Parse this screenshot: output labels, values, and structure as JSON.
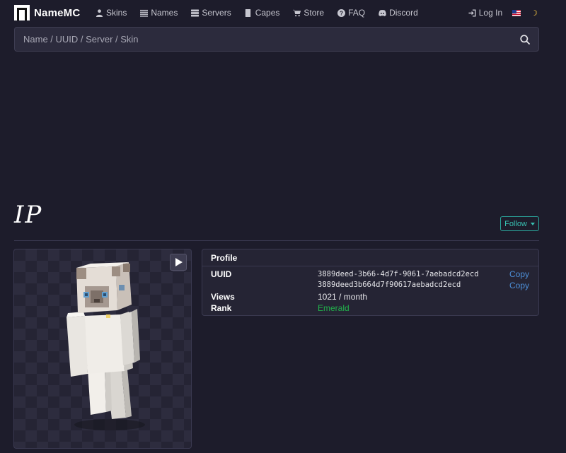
{
  "brand": {
    "name": "NameMC"
  },
  "nav": {
    "items": [
      {
        "label": "Skins",
        "icon": "person-icon"
      },
      {
        "label": "Names",
        "icon": "list-icon"
      },
      {
        "label": "Servers",
        "icon": "server-icon"
      },
      {
        "label": "Capes",
        "icon": "cape-icon"
      },
      {
        "label": "Store",
        "icon": "cart-icon"
      },
      {
        "label": "FAQ",
        "icon": "question-icon"
      },
      {
        "label": "Discord",
        "icon": "discord-icon"
      }
    ],
    "login_label": "Log In",
    "language": "us-flag-icon",
    "theme": "moon-icon"
  },
  "search": {
    "placeholder": "Name / UUID / Server / Skin",
    "value": ""
  },
  "profile": {
    "username": "IP",
    "follow_label": "Follow",
    "card_title": "Profile",
    "uuid_label": "UUID",
    "uuid_dashed": "3889deed-3b66-4d7f-9061-7aebadcd2ecd",
    "uuid_plain": "3889deed3b664d7f90617aebadcd2ecd",
    "copy_label": "Copy",
    "views_label": "Views",
    "views_value": "1021 / month",
    "rank_label": "Rank",
    "rank_value": "Emerald"
  },
  "colors": {
    "background": "#1d1c2b",
    "accent_teal": "#38c0b2",
    "link_blue": "#4d8fd8",
    "rank_green": "#22b14c"
  }
}
